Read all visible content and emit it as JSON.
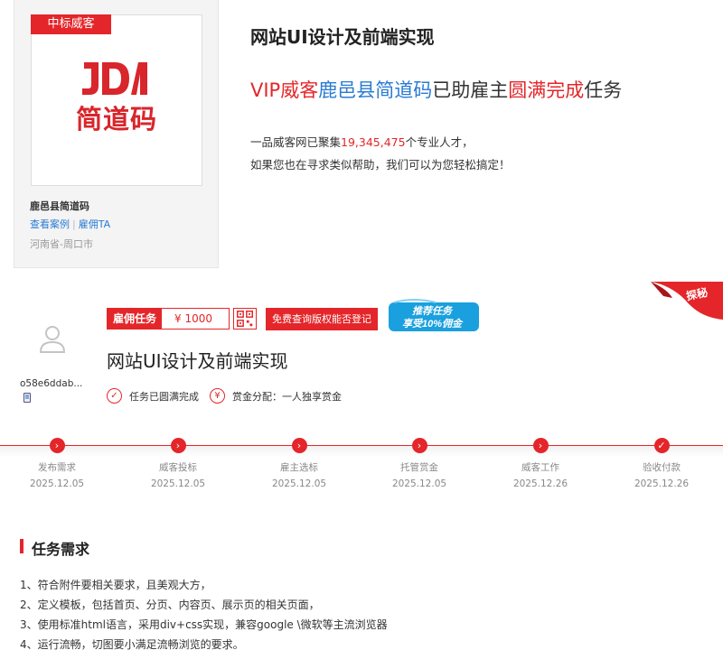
{
  "company": {
    "badge": "中标威客",
    "logo_text": "简道码",
    "name": "鹿邑县简道码",
    "links": [
      "查看案例",
      "雇佣TA"
    ],
    "region": "河南省-周口市"
  },
  "hero": {
    "title": "网站UI设计及前端实现",
    "sub_vip": "VIP威客",
    "sub_company": "鹿邑县简道码",
    "sub_mid": "已助雇主",
    "sub_done": "圆满完成",
    "sub_end": "任务",
    "line1_pre": "一品威客网已聚集",
    "line1_count": "19,345,475",
    "line1_post": "个专业人才，",
    "line2": "如果您也在寻求类似帮助，我们可以为您轻松搞定！"
  },
  "task": {
    "user": "o58e6ddab...",
    "reward_label": "雇佣任务",
    "reward_amount": "¥ 1000",
    "query_button": "免费查询版权能否登记",
    "promo_line1": "推荐任务",
    "promo_line2": "享受10%佣金",
    "corner_badge": "探秘",
    "title": "网站UI设计及前端实现",
    "status": "任务已圆满完成",
    "bounty": "赏金分配：一人独享赏金"
  },
  "timeline": [
    {
      "label": "发布需求",
      "date": "2025.12.05",
      "icon": "arrow-right-icon"
    },
    {
      "label": "威客投标",
      "date": "2025.12.05",
      "icon": "arrow-right-icon"
    },
    {
      "label": "雇主选标",
      "date": "2025.12.05",
      "icon": "arrow-right-icon"
    },
    {
      "label": "托管赏金",
      "date": "2025.12.05",
      "icon": "arrow-right-icon"
    },
    {
      "label": "威客工作",
      "date": "2025.12.26",
      "icon": "arrow-right-icon"
    },
    {
      "label": "验收付款",
      "date": "2025.12.26",
      "icon": "check-icon"
    }
  ],
  "requirements": {
    "title": "任务需求",
    "items": [
      "1、符合附件要相关要求，且美观大方，",
      "2、定义模板，包括首页、分页、内容页、展示页的相关页面，",
      "3、使用标准html语言，采用div+css实现，兼容google \\微软等主流浏览器",
      "4、运行流畅，切图要小满足流畅浏览的要求。"
    ]
  },
  "colors": {
    "accent": "#e4262a",
    "link": "#2a7bd4"
  }
}
